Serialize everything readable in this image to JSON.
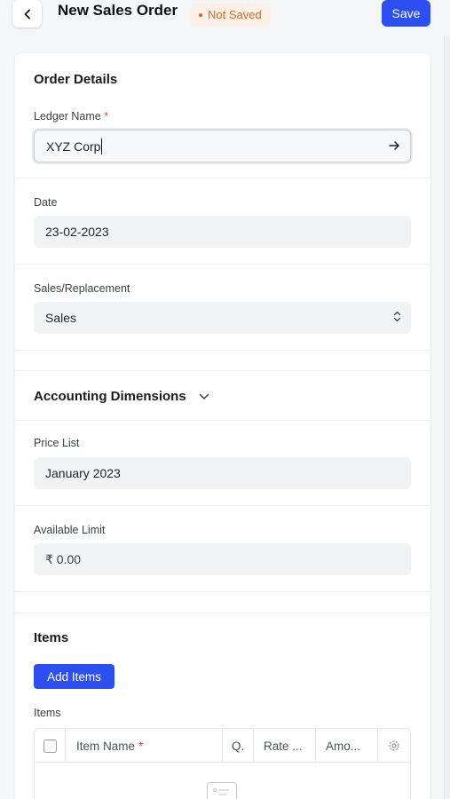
{
  "header": {
    "title": "New Sales Order",
    "status": "Not Saved",
    "save_label": "Save",
    "back_icon": "chevron-left-icon"
  },
  "colors": {
    "accent": "#2d4ff0",
    "status": "#d86a26",
    "required": "#e0443b"
  },
  "order_details": {
    "title": "Order Details",
    "ledger_label": "Ledger Name",
    "ledger_value": "XYZ Corp",
    "ledger_trail_icon": "arrow-right-icon",
    "date_label": "Date",
    "date_value": "23-02-2023",
    "sales_label": "Sales/Replacement",
    "sales_value": "Sales",
    "sales_trail_icon": "select-updown-icon"
  },
  "accounting": {
    "title": "Accounting Dimensions",
    "toggle_icon": "chevron-down-icon",
    "price_list_label": "Price List",
    "price_list_value": "January 2023",
    "available_label": "Available Limit",
    "available_value": "₹ 0.00"
  },
  "items": {
    "title": "Items",
    "add_label": "Add Items",
    "table_label": "Items",
    "columns": [
      "Item Name",
      "Q.",
      "Rate ...",
      "Amo..."
    ],
    "settings_icon": "gear-icon",
    "empty_icon": "list-empty-icon"
  }
}
